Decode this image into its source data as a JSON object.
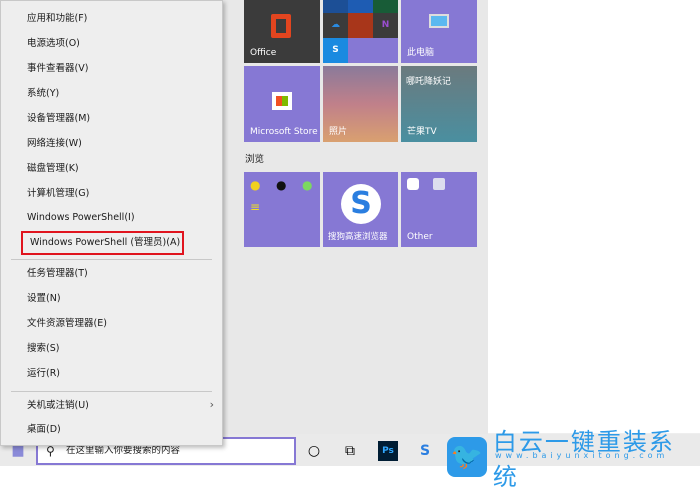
{
  "menu": {
    "items": [
      "应用和功能(F)",
      "电源选项(O)",
      "事件查看器(V)",
      "系统(Y)",
      "设备管理器(M)",
      "网络连接(W)",
      "磁盘管理(K)",
      "计算机管理(G)",
      "Windows PowerShell(I)",
      "Windows PowerShell (管理员)(A)",
      "任务管理器(T)",
      "设置(N)",
      "文件资源管理器(E)",
      "搜索(S)",
      "运行(R)",
      "关机或注销(U)",
      "桌面(D)"
    ],
    "highlighted": "Windows PowerShell (管理员)(A)"
  },
  "tiles": {
    "office": "Office",
    "pc": "此电脑",
    "store": "Microsoft Store",
    "photos": "照片",
    "mango": "芒果TV",
    "mango_text": "哪吒降妖记",
    "group": "浏览",
    "sogou": "搜狗高速浏览器",
    "other": "Other"
  },
  "taskbar": {
    "search_placeholder": "在这里输入你要搜索的内容"
  },
  "watermark": {
    "title": "白云一键重装系统",
    "url": "www.baiyunxitong.com"
  },
  "colors": {
    "tile": "#8678d4",
    "highlight": "#e0141e"
  }
}
